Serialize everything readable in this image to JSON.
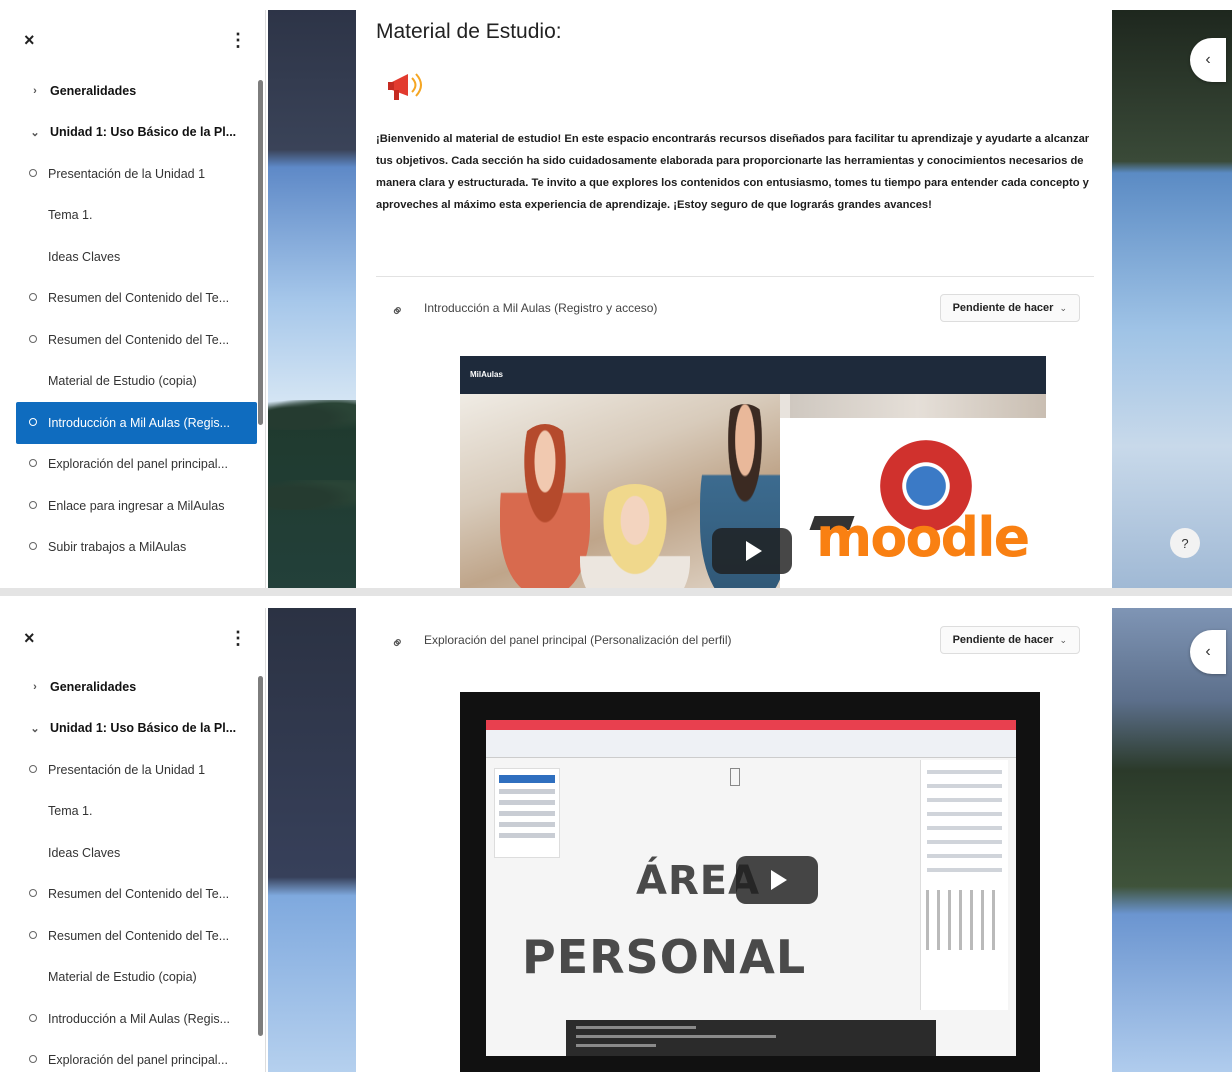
{
  "sidebar": {
    "close_icon": "×",
    "kebab_icon": "⋮",
    "items": [
      {
        "label": "Generalidades",
        "prefix": "›",
        "kind": "section"
      },
      {
        "label": "Unidad 1: Uso Básico de la Pl...",
        "prefix": "⌄",
        "kind": "section"
      },
      {
        "label": "Presentación de la Unidad 1",
        "kind": "activity"
      },
      {
        "label": "Tema 1.",
        "kind": "page"
      },
      {
        "label": "Ideas Claves",
        "kind": "page"
      },
      {
        "label": "Resumen del Contenido del Te...",
        "kind": "activity"
      },
      {
        "label": "Resumen del Contenido del Te...",
        "kind": "activity"
      },
      {
        "label": "Material de Estudio (copia)",
        "kind": "page"
      },
      {
        "label": "Introducción a Mil Aulas (Regis...",
        "kind": "activity"
      },
      {
        "label": "Exploración del panel principal...",
        "kind": "activity"
      },
      {
        "label": "Enlace para ingresar a MilAulas",
        "kind": "activity"
      },
      {
        "label": "Subir trabajos a MilAulas",
        "kind": "activity"
      },
      {
        "label": "Exploración del panel principal...",
        "kind": "activity"
      }
    ]
  },
  "view1": {
    "page_title": "Material de Estudio:",
    "intro_text": "¡Bienvenido al material de estudio! En este espacio encontrarás recursos diseñados para facilitar tu aprendizaje y ayudarte a alcanzar tus objetivos. Cada sección ha sido cuidadosamente elaborada para proporcionarte las herramientas y conocimientos necesarios de manera clara y estructurada. Te invito a que explores los contenidos con entusiasmo, tomes tu tiempo para entender cada concepto y aproveches al máximo esta experiencia de aprendizaje. ¡Estoy seguro de que lograrás grandes avances!",
    "activity_name": "Introducción a Mil Aulas (Registro y acceso)",
    "status_label": "Pendiente de hacer",
    "video_bar_label": "MilAulas",
    "video_logo_text": "moodle",
    "help_label": "?",
    "collapse_icon": "‹"
  },
  "view2": {
    "activity_name": "Exploración del panel principal (Personalización del perfil)",
    "status_label": "Pendiente de hacer",
    "video_title_line1": "ÁREA",
    "video_title_line2": "PERSONAL",
    "collapse_icon": "‹"
  },
  "colors": {
    "accent": "#0f6cbf",
    "moodle_orange": "#f98012",
    "red_bar": "#e8404f"
  }
}
